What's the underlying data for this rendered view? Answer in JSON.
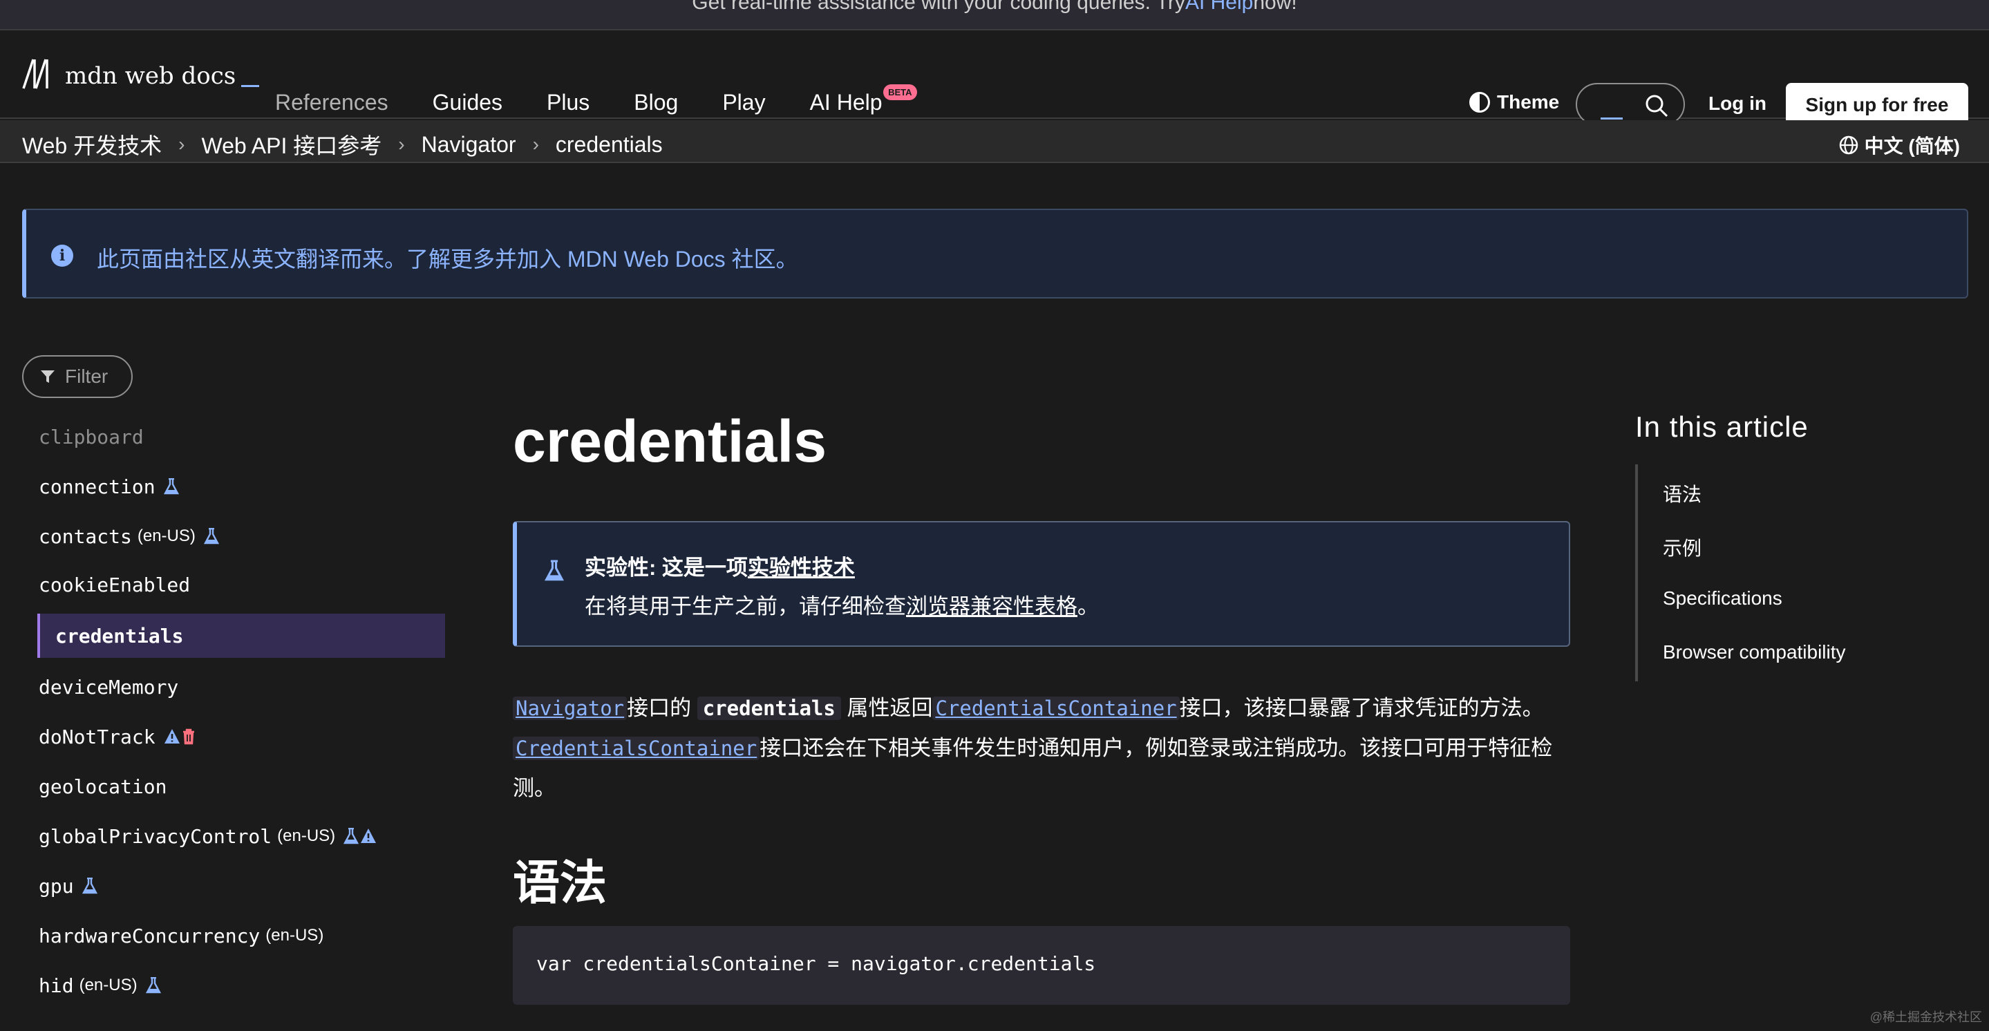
{
  "banner": {
    "text": "Get real-time assistance with your coding queries. Try ",
    "link": "AI Help",
    "suffix": " now!"
  },
  "header": {
    "logo_text": "mdn web docs",
    "nav": [
      {
        "label": "References"
      },
      {
        "label": "Guides"
      },
      {
        "label": "Plus"
      },
      {
        "label": "Blog"
      },
      {
        "label": "Play"
      },
      {
        "label": "AI Help",
        "badge": "BETA"
      }
    ],
    "theme_label": "Theme",
    "login_label": "Log in",
    "signup_label": "Sign up for free"
  },
  "breadcrumb": [
    "Web 开发技术",
    "Web API 接口参考",
    "Navigator",
    "credentials"
  ],
  "language": "中文 (简体)",
  "translation_notice": "此页面由社区从英文翻译而来。了解更多并加入 MDN Web Docs 社区。",
  "sidebar": {
    "filter_placeholder": "Filter",
    "items": [
      {
        "name": "clipboard",
        "locale": "",
        "faded": true
      },
      {
        "name": "connection",
        "locale": ""
      },
      {
        "name": "contacts",
        "locale": "(en-US)"
      },
      {
        "name": "cookieEnabled",
        "locale": ""
      },
      {
        "name": "credentials",
        "locale": "",
        "active": true
      },
      {
        "name": "deviceMemory",
        "locale": ""
      },
      {
        "name": "doNotTrack",
        "locale": ""
      },
      {
        "name": "geolocation",
        "locale": ""
      },
      {
        "name": "globalPrivacyControl",
        "locale": "(en-US)"
      },
      {
        "name": "gpu",
        "locale": ""
      },
      {
        "name": "hardwareConcurrency",
        "locale": "(en-US)"
      },
      {
        "name": "hid",
        "locale": "(en-US)"
      }
    ]
  },
  "article": {
    "title": "credentials",
    "experimental": {
      "title_prefix": "实验性: 这是一项",
      "title_link": "实验性技术",
      "desc_prefix": "在将其用于生产之前，请仔细检查",
      "desc_link": "浏览器兼容性表格",
      "desc_suffix": "。"
    },
    "intro": {
      "link1": "Navigator",
      "t1": "接口的",
      "code1": "credentials",
      "t2": "属性返回",
      "link2": "CredentialsContainer",
      "t3": "接口，该接口暴露了请求凭证的方法。",
      "link3": "CredentialsContainer",
      "t4": "接口还会在下相关事件发生时通知用户，例如登录或注销成功。该接口可用于特征检测。"
    },
    "syntax_heading": "语法",
    "code": "var credentialsContainer = navigator.credentials"
  },
  "toc": {
    "title": "In this article",
    "items": [
      "语法",
      "示例",
      "Specifications",
      "Browser compatibility"
    ]
  },
  "watermark": "@稀土掘金技术社区",
  "colors": {
    "accent": "#8cb4ff",
    "active_bg": "#352c54",
    "active_border": "#9e7be8",
    "background": "#1b1b1b"
  }
}
